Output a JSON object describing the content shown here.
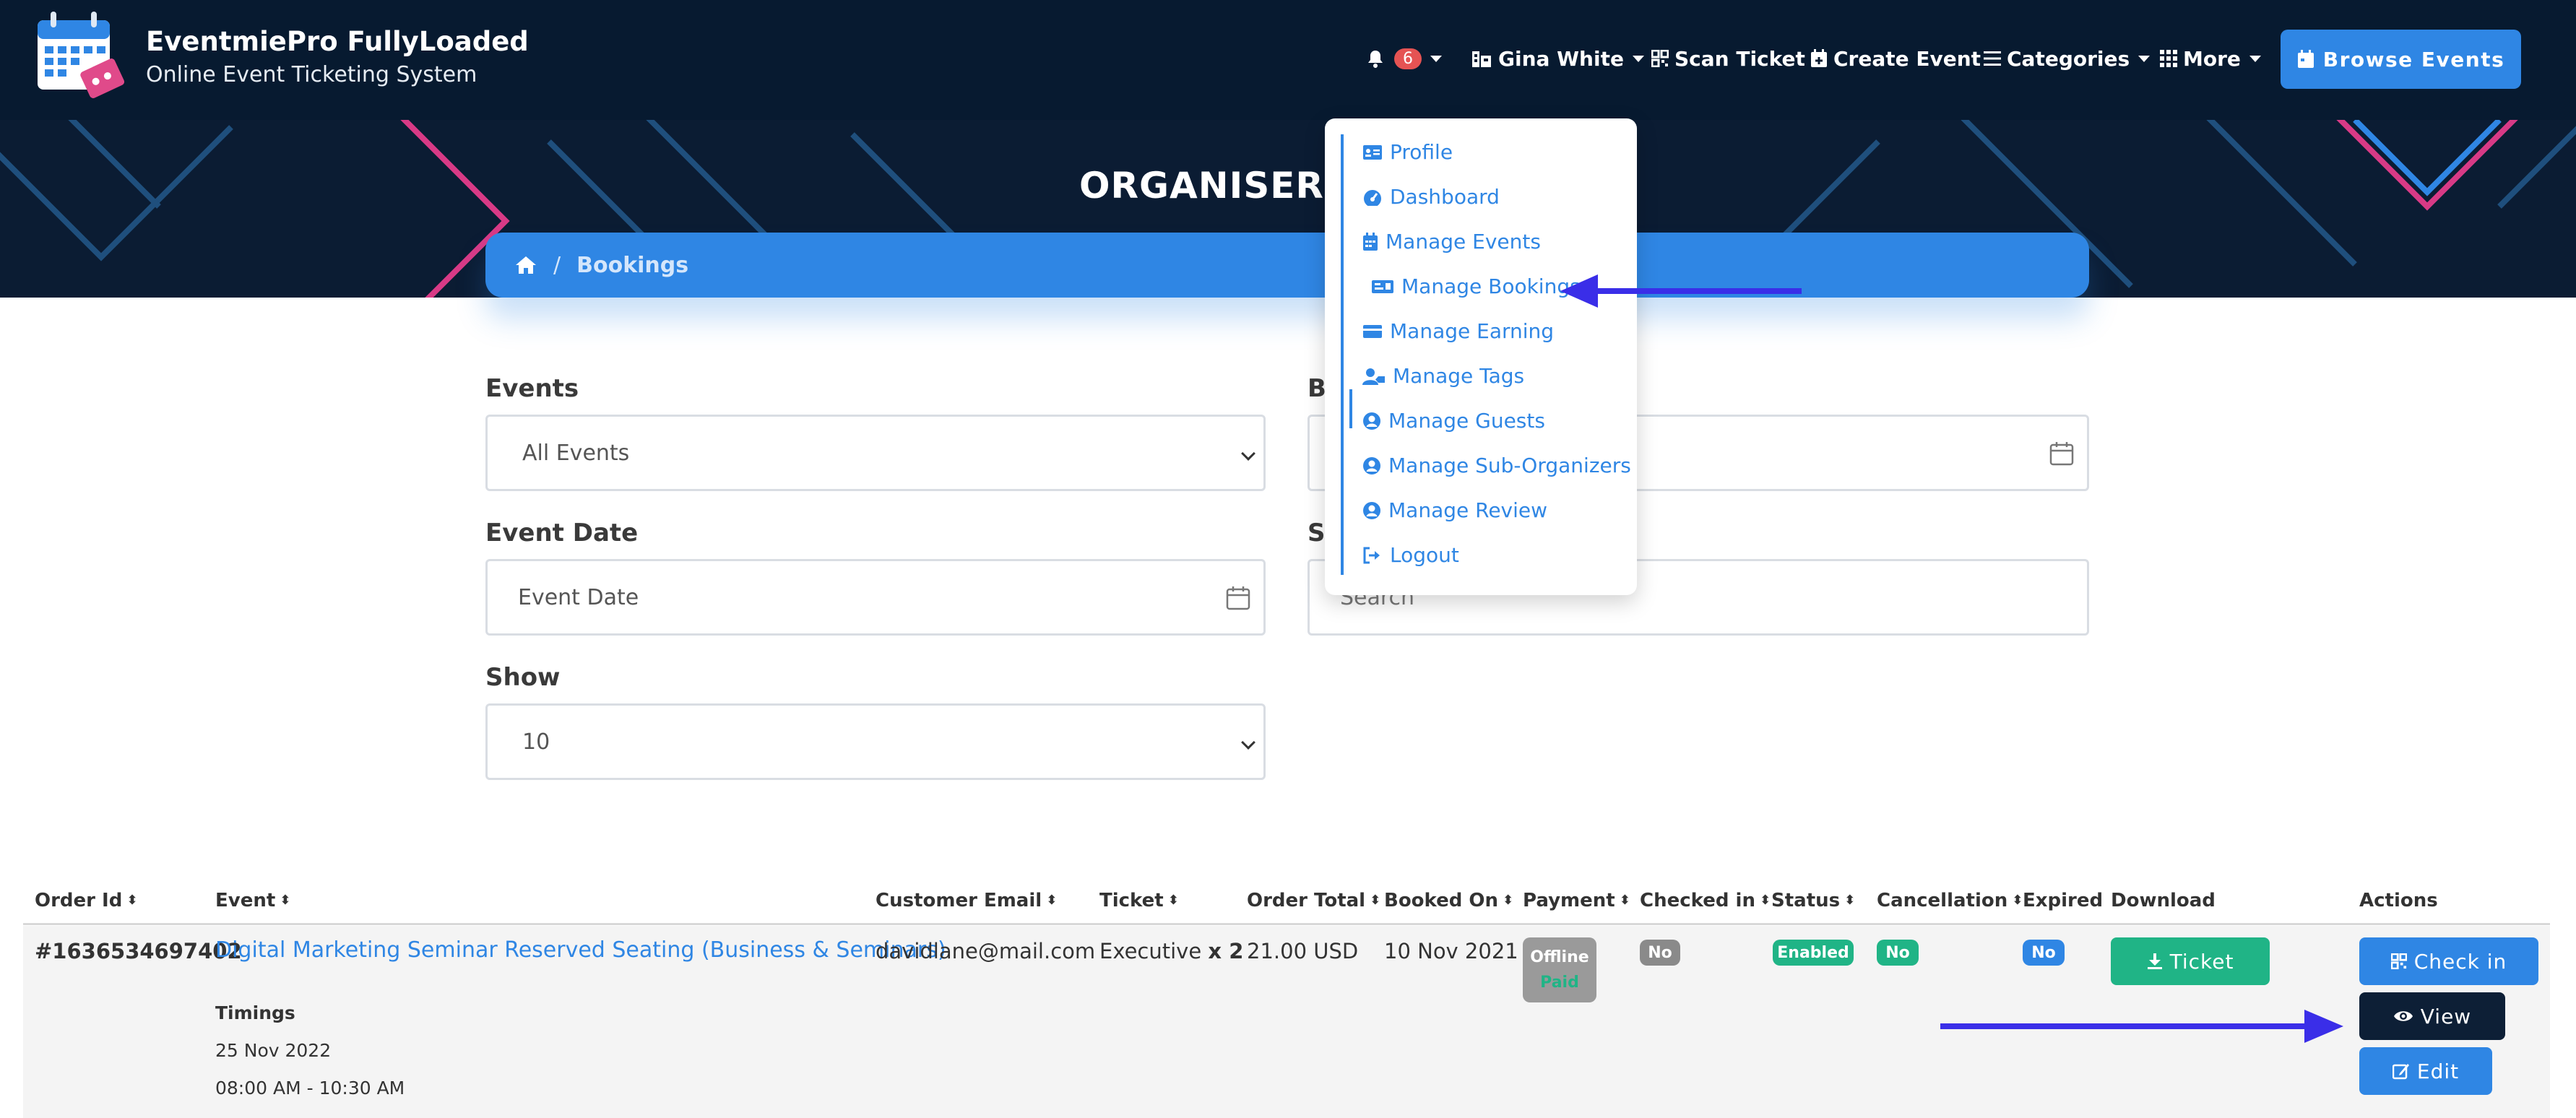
{
  "brand": {
    "title": "EventmiePro FullyLoaded",
    "subtitle": "Online Event Ticketing System"
  },
  "nav": {
    "notification_count": "6",
    "user_name": "Gina White",
    "scan_ticket": "Scan Ticket",
    "create_event": "Create Event",
    "categories": "Categories",
    "more": "More",
    "browse_events": "Browse Events"
  },
  "hero": {
    "title": "ORGANISER B"
  },
  "breadcrumb": {
    "current": "Bookings"
  },
  "dropdown": {
    "items": [
      {
        "label": "Profile",
        "icon": "id-card-icon"
      },
      {
        "label": "Dashboard",
        "icon": "gauge-icon"
      },
      {
        "label": "Manage Events",
        "icon": "calendar-icon"
      },
      {
        "label": "Manage Bookings",
        "icon": "ticket-icon"
      },
      {
        "label": "Manage Earning",
        "icon": "wallet-icon"
      },
      {
        "label": "Manage Tags",
        "icon": "user-tag-icon"
      },
      {
        "label": "Manage Guests",
        "icon": "user-circle-icon"
      },
      {
        "label": "Manage Sub-Organizers",
        "icon": "user-circle-icon"
      },
      {
        "label": "Manage Review",
        "icon": "user-circle-icon"
      },
      {
        "label": "Logout",
        "icon": "sign-out-icon"
      }
    ]
  },
  "filters": {
    "events_label": "Events",
    "events_value": "All Events",
    "booking_date_label_partial": "B",
    "event_date_label": "Event Date",
    "event_date_placeholder": "Event Date",
    "search_label_partial": "S",
    "search_placeholder": "Search",
    "show_label": "Show",
    "show_value": "10"
  },
  "table": {
    "headers": {
      "order_id": "Order Id",
      "event": "Event",
      "customer_email": "Customer Email",
      "ticket": "Ticket",
      "order_total": "Order Total",
      "booked_on": "Booked On",
      "payment": "Payment",
      "checked_in": "Checked in",
      "status": "Status",
      "cancellation": "Cancellation",
      "expired": "Expired",
      "download": "Download",
      "actions": "Actions"
    },
    "row": {
      "order_id": "#1636534697402",
      "event": "Digital Marketing Seminar Reserved Seating (Business & Seminars)",
      "timings_label": "Timings",
      "date": "25 Nov 2022",
      "time": "08:00 AM - 10:30 AM",
      "email": "davidlane@mail.com",
      "ticket_name": "Executive",
      "ticket_qty": "x 2",
      "total": "21.00 USD",
      "booked_on": "10 Nov 2021",
      "payment_method": "Offline",
      "payment_status": "Paid",
      "checked_in": "No",
      "status": "Enabled",
      "cancellation": "No",
      "expired": "No",
      "download_label": "Ticket",
      "checkin_label": "Check in",
      "view_label": "View",
      "edit_label": "Edit"
    }
  },
  "colors": {
    "navy": "#071a30",
    "primary": "#2f86e4",
    "success": "#20b486",
    "dark_button": "#0d1f36",
    "annotation_arrow": "#3a2ee8"
  }
}
